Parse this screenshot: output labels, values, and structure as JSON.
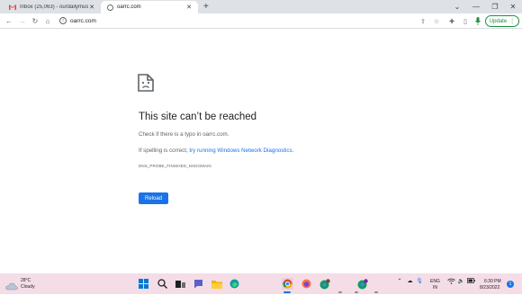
{
  "tabs": [
    {
      "title": "Inbox (25,063) - ourdailymusing",
      "favicon": "gmail-icon",
      "active": false
    },
    {
      "title": "oarrc.com",
      "favicon": "page-icon",
      "active": true
    }
  ],
  "new_tab_icon": "plus-icon",
  "window_controls": {
    "dropdown": "chevron-down-icon",
    "minimize": "minimize-icon",
    "restore": "restore-icon",
    "close": "close-icon"
  },
  "toolbar": {
    "url": "oarrc.com",
    "site_info_icon": "info-icon",
    "update_label": "Update"
  },
  "error": {
    "title": "This site can’t be reached",
    "line1": "Check if there is a typo in oarrc.com.",
    "line2_prefix": "If spelling is correct, ",
    "line2_link": "try running Windows Network Diagnostics",
    "line2_suffix": ".",
    "code": "DNS_PROBE_FINISHED_NXDOMAIN",
    "reload_label": "Reload"
  },
  "taskbar": {
    "weather_temp": "28°C",
    "weather_condition": "Cloudy",
    "lang_line1": "ENG",
    "lang_line2": "IN",
    "time": "6:30 PM",
    "date": "8/23/2022",
    "notification_count": "1"
  },
  "colors": {
    "accent": "#1a73e8",
    "update_green": "#1e8e3e",
    "taskbar_bg": "#f4dde6"
  }
}
